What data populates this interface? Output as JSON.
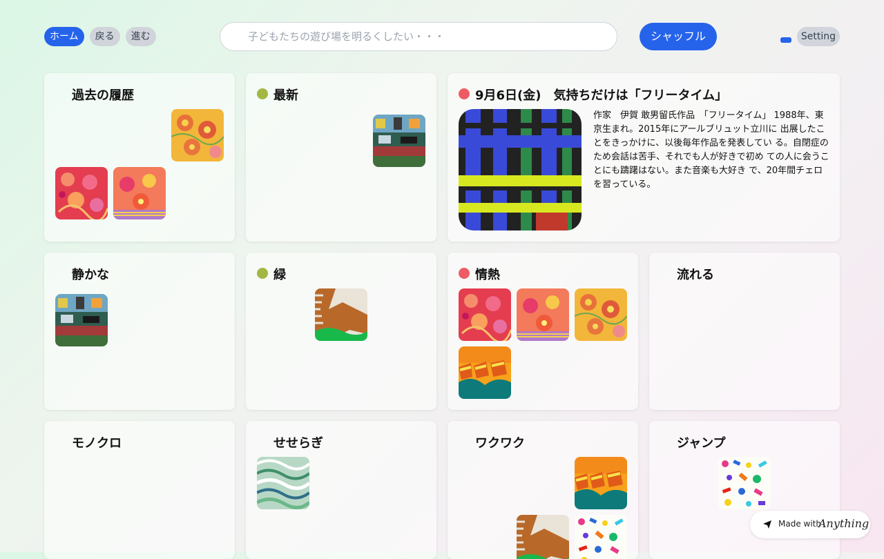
{
  "nav": {
    "home": "ホーム",
    "back": "戻る",
    "forward": "進む"
  },
  "search": {
    "placeholder": "子どもたちの遊び場を明るくしたい・・・",
    "value": ""
  },
  "shuffle_label": "シャッフル",
  "setting_label": "Setting",
  "cards": {
    "history": {
      "title": "過去の履歴"
    },
    "latest": {
      "title": "最新"
    },
    "feature": {
      "title": "9月6日(金)　気持ちだけは「フリータイム」",
      "description": "作家　伊賀 敢男留氏作品　「フリータイム」 1988年、東京生まれ。2015年にアールブリュット立川に 出展したことをきっかけに、以後毎年作品を発表してい る。自閉症のため会話は苦手、それでも人が好きで初め ての人に会うことにも躊躇はない。また音楽も大好き で、20年間チェロを習っている。"
    },
    "quiet": {
      "title": "静かな"
    },
    "green": {
      "title": "緑"
    },
    "passion": {
      "title": "情熱"
    },
    "flowing": {
      "title": "流れる"
    },
    "mono": {
      "title": "モノクロ"
    },
    "murmur": {
      "title": "せせらぎ"
    },
    "excite": {
      "title": "ワクワク"
    },
    "jump": {
      "title": "ジャンプ"
    }
  },
  "badge": {
    "made_with": "Made with",
    "brand": "Anything"
  },
  "colors": {
    "accent": "#2563eb",
    "dot_green": "#a3b745",
    "dot_red": "#ef5b64"
  },
  "icons": [
    "artwork-thumbnail",
    "dot-indicator",
    "anything-logo-icon"
  ]
}
